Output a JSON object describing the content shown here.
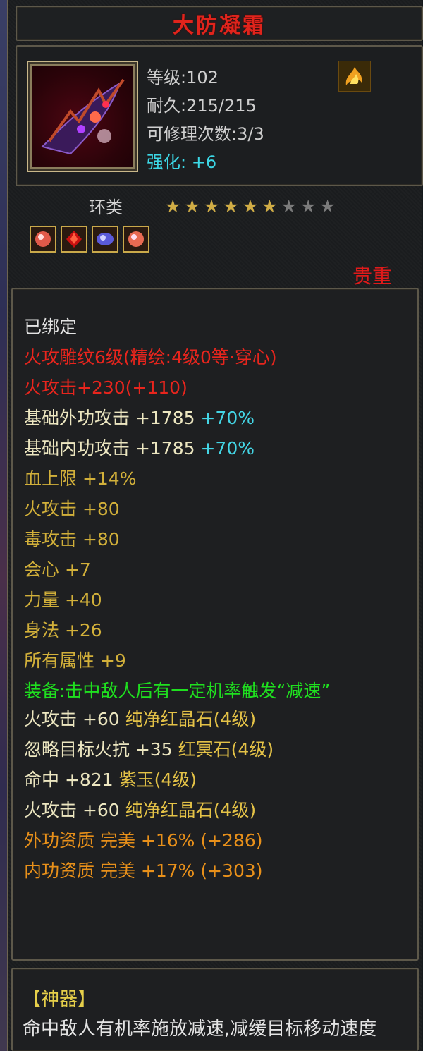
{
  "item": {
    "name": "大防凝霜",
    "level": "等级:102",
    "durability": "耐久:215/215",
    "repair": "可修理次数:3/3",
    "enhance": "强化: +6",
    "type": "环类",
    "rarity": "贵重",
    "stars_on": 6,
    "stars_total": 9
  },
  "attributes": [
    {
      "text": "已绑定",
      "color": "white"
    },
    {
      "text": "火攻雕纹6级(精绘:4级0等·穿心)",
      "color": "red"
    },
    {
      "text": "火攻击+230(+110)",
      "color": "red"
    },
    {
      "text": "基础外功攻击 +1785",
      "color": "cream",
      "extra": "+70%"
    },
    {
      "text": "基础内功攻击 +1785",
      "color": "cream",
      "extra": "+70%"
    },
    {
      "text": "血上限 +14%",
      "color": "yellow"
    },
    {
      "text": "火攻击 +80",
      "color": "yellow"
    },
    {
      "text": "毒攻击 +80",
      "color": "yellow"
    },
    {
      "text": "会心 +7",
      "color": "yellow"
    },
    {
      "text": "力量 +40",
      "color": "yellow"
    },
    {
      "text": "身法 +26",
      "color": "yellow"
    },
    {
      "text": "所有属性 +9",
      "color": "yellow"
    },
    {
      "text": "装备:击中敌人后有一定机率触发“减速”",
      "color": "green",
      "wrap": true
    },
    {
      "text": "火攻击 +60",
      "color": "white",
      "gem": "纯净红晶石(4级)"
    },
    {
      "text": "忽略目标火抗 +35",
      "color": "white",
      "gem": "红冥石(4级)"
    },
    {
      "text": "命中 +821",
      "color": "white",
      "gem": "紫玉(4级)"
    },
    {
      "text": "火攻击 +60",
      "color": "white",
      "gem": "纯净红晶石(4级)"
    },
    {
      "text": "外功资质  完美 +16% (+286)",
      "color": "orange"
    },
    {
      "text": "内功资质  完美 +17% (+303)",
      "color": "orange"
    }
  ],
  "artifact": {
    "title": "【神器】",
    "desc": "命中敌人有机率施放减速,减缓目标移动速度"
  },
  "colors": {
    "title_red": "#e0241c",
    "rarity_red": "#e01a1a",
    "enhance_cyan": "#3cd8e6",
    "star_gold": "#d1ad45"
  }
}
